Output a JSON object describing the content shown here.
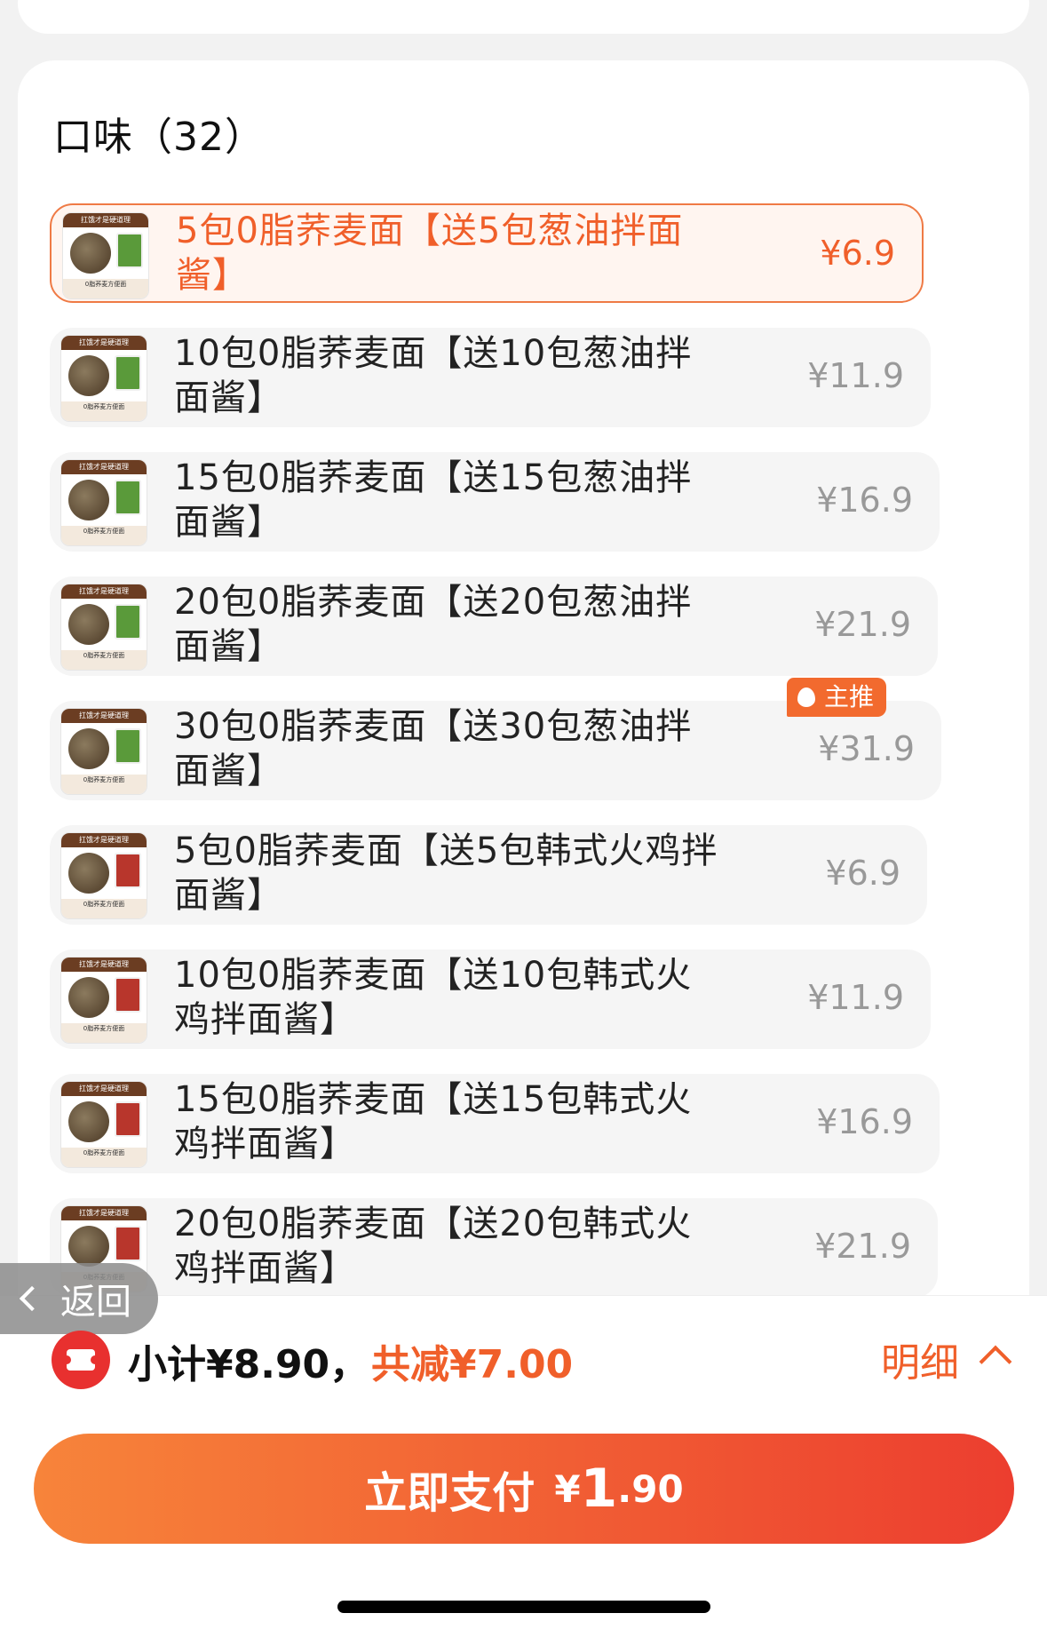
{
  "section": {
    "title": "口味（32）"
  },
  "options": [
    {
      "text": "5包0脂荞麦面【送5包葱油拌面酱】",
      "price": "¥6.9",
      "selected": true,
      "sauce": "green"
    },
    {
      "text": "10包0脂荞麦面【送10包葱油拌面酱】",
      "price": "¥11.9",
      "sauce": "green"
    },
    {
      "text": "15包0脂荞麦面【送15包葱油拌面酱】",
      "price": "¥16.9",
      "sauce": "green"
    },
    {
      "text": "20包0脂荞麦面【送20包葱油拌面酱】",
      "price": "¥21.9",
      "sauce": "green"
    },
    {
      "text": "30包0脂荞麦面【送30包葱油拌面酱】",
      "price": "¥31.9",
      "sauce": "green"
    },
    {
      "text": "5包0脂荞麦面【送5包韩式火鸡拌面酱】",
      "price": "¥6.9",
      "sauce": "red"
    },
    {
      "text": "10包0脂荞麦面【送10包韩式火鸡拌面酱】",
      "price": "¥11.9",
      "sauce": "red"
    },
    {
      "text": "15包0脂荞麦面【送15包韩式火鸡拌面酱】",
      "price": "¥16.9",
      "sauce": "red"
    },
    {
      "text": "20包0脂荞麦面【送20包韩式火鸡拌面酱】",
      "price": "¥21.9",
      "sauce": "red"
    }
  ],
  "badge": {
    "label": "主推"
  },
  "thumb": {
    "top_text": "扛饿才是硬道理",
    "bottom_text": "0脂荞麦方便面"
  },
  "back": {
    "label": "返回"
  },
  "summary": {
    "subtotal": "小计¥8.90，",
    "discount": "共减¥7.00",
    "detail": "明细"
  },
  "pay": {
    "label": "立即支付",
    "currency": "¥",
    "int": "1",
    "dec": ".90"
  },
  "colors": {
    "accent": "#f05f2a",
    "selected_bg": "#fff5f0",
    "coupon_red": "#e8302f"
  }
}
